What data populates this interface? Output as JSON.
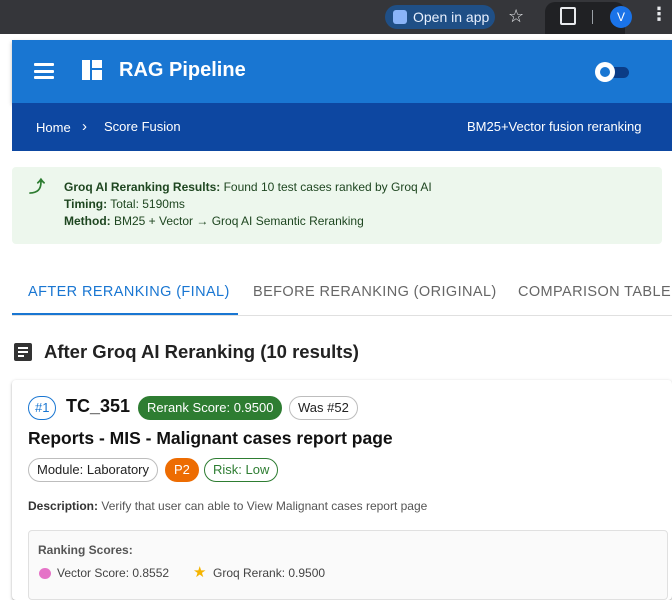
{
  "browser": {
    "open_in_app_label": "Open in app",
    "profile_initial": "V",
    "icons": [
      "star-icon",
      "extensions-icon",
      "more-vert-icon"
    ]
  },
  "appbar": {
    "title": "RAG Pipeline",
    "icons": [
      "menu-icon",
      "dashboard-icon",
      "theme-toggle"
    ],
    "color": "#1976d2"
  },
  "breadcrumb": {
    "home": "Home",
    "current": "Score Fusion",
    "right_text": "BM25+Vector fusion reranking",
    "color": "#0d47a1"
  },
  "alert": {
    "line1_label": "Groq AI Reranking Results:",
    "line1_text": " Found 10 test cases ranked by Groq AI",
    "line2_label": "Timing:",
    "line2_text": " Total: 5190ms",
    "line3_label": "Method:",
    "line3_text": " BM25 + Vector → Groq AI Semantic Reranking",
    "color": "#edf7ed"
  },
  "tabs": [
    {
      "label": "AFTER RERANKING (FINAL)",
      "active": true
    },
    {
      "label": "BEFORE RERANKING (ORIGINAL)",
      "active": false
    },
    {
      "label": "COMPARISON TABLE",
      "active": false
    }
  ],
  "section": {
    "heading": "After Groq AI Reranking (10 results)"
  },
  "result": {
    "rank": "#1",
    "id": "TC_351",
    "rerank_score": "Rerank Score: 0.9500",
    "was": "Was #52",
    "title": "Reports - MIS - Malignant cases report page",
    "module": "Module: Laboratory",
    "priority": "P2",
    "risk": "Risk: Low",
    "description_label": "Description:",
    "description": " Verify that user can able to View Malignant cases report page",
    "scores_label": "Ranking Scores:",
    "vector_score": "Vector Score: 0.8552",
    "groq_rerank": "Groq Rerank: 0.9500",
    "colors": {
      "score": "#2e7d32",
      "priority": "#ed6c02",
      "rank": "#1976d2"
    }
  }
}
